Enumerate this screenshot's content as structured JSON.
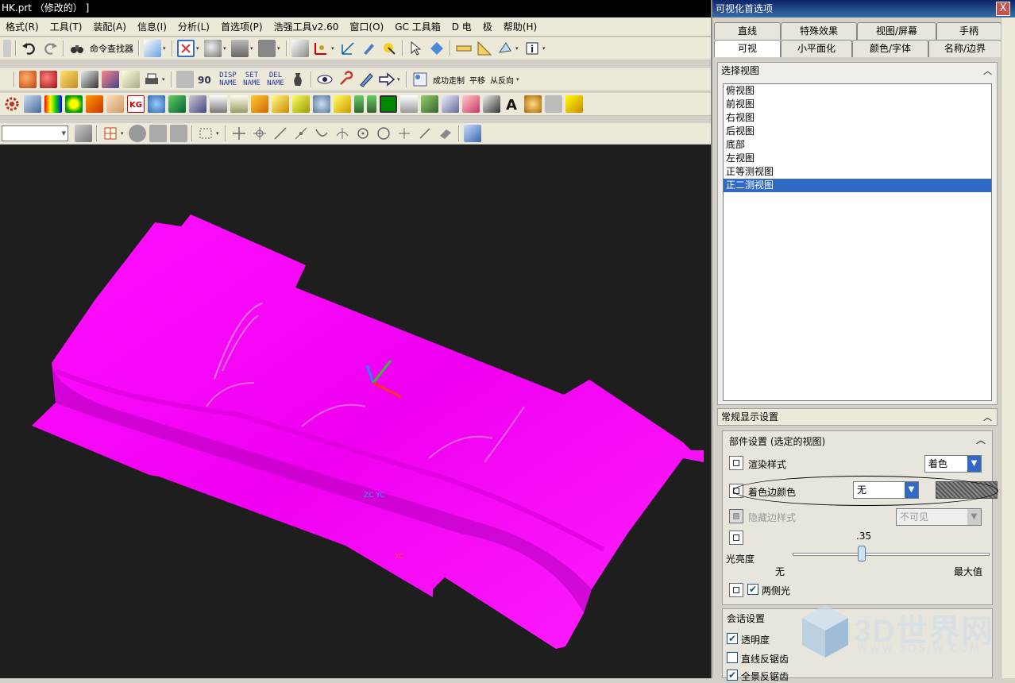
{
  "window": {
    "title": "HK.prt （修改的） ]"
  },
  "menu": [
    "格式(R)",
    "工具(T)",
    "装配(A)",
    "信息(I)",
    "分析(L)",
    "首选项(P)",
    "浩强工具v2.60",
    "窗口(O)",
    "GC 工具箱",
    "D 电",
    "极",
    "帮助(H)"
  ],
  "toolbar1": {
    "command_finder": "命令查找器"
  },
  "toolbar2": {
    "disp_name": "DISP NAME",
    "set_name": "SET NAME",
    "del_name": "DEL NAME",
    "btn_a": "成功走制",
    "btn_b": "平移",
    "btn_c": "从反向"
  },
  "viewport": {
    "triad_label": "ZC YC",
    "triad_xc": "XC",
    "part_color": "#ff00ff"
  },
  "dialog": {
    "title": "可视化首选项",
    "close": "X",
    "tabs_row1": [
      "直线",
      "特殊效果",
      "视图/屏幕",
      "手柄"
    ],
    "tabs_row2": [
      "可视",
      "小平面化",
      "颜色/字体",
      "名称/边界"
    ],
    "active_tab": "可视",
    "select_view_group": "选择视图",
    "views": [
      "俯视图",
      "前视图",
      "右视图",
      "后视图",
      "底部",
      "左视图",
      "正等测视图",
      "正二测视图"
    ],
    "selected_view": "正二测视图",
    "general_display": "常规显示设置",
    "part_settings": "部件设置 (选定的视图)",
    "render_style_label": "渲染样式",
    "render_style_value": "着色",
    "shaded_edge_label": "着色边颜色",
    "shaded_edge_value": "无",
    "hidden_edge_label": "隐藏边样式",
    "hidden_edge_value": "不可见",
    "brightness_value": ".35",
    "brightness_fraction": 0.35,
    "brightness_label": "光亮度",
    "brightness_min": "无",
    "brightness_max": "最大值",
    "two_sided_light": "两侧光",
    "session_settings": "会话设置",
    "transparency": "透明度",
    "line_antialias": "直线反锯齿",
    "full_antialias": "全景反锯齿"
  },
  "watermark": {
    "text": "3D世界网",
    "sub": "WWW.3DSJW.COM"
  }
}
